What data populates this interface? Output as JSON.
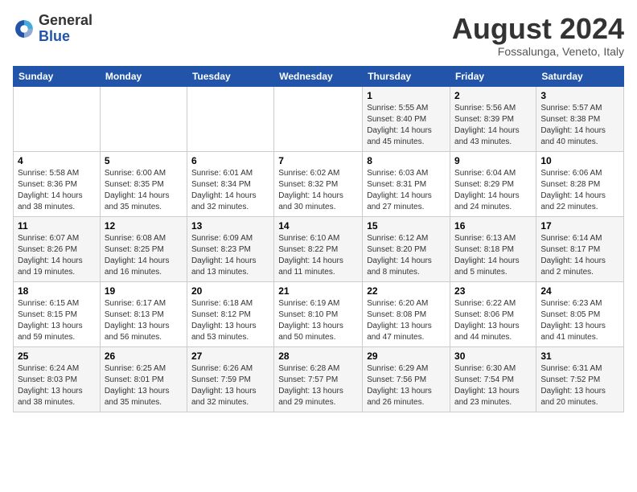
{
  "header": {
    "logo_line1": "General",
    "logo_line2": "Blue",
    "month": "August 2024",
    "location": "Fossalunga, Veneto, Italy"
  },
  "weekdays": [
    "Sunday",
    "Monday",
    "Tuesday",
    "Wednesday",
    "Thursday",
    "Friday",
    "Saturday"
  ],
  "weeks": [
    [
      {
        "day": "",
        "detail": ""
      },
      {
        "day": "",
        "detail": ""
      },
      {
        "day": "",
        "detail": ""
      },
      {
        "day": "",
        "detail": ""
      },
      {
        "day": "1",
        "detail": "Sunrise: 5:55 AM\nSunset: 8:40 PM\nDaylight: 14 hours\nand 45 minutes."
      },
      {
        "day": "2",
        "detail": "Sunrise: 5:56 AM\nSunset: 8:39 PM\nDaylight: 14 hours\nand 43 minutes."
      },
      {
        "day": "3",
        "detail": "Sunrise: 5:57 AM\nSunset: 8:38 PM\nDaylight: 14 hours\nand 40 minutes."
      }
    ],
    [
      {
        "day": "4",
        "detail": "Sunrise: 5:58 AM\nSunset: 8:36 PM\nDaylight: 14 hours\nand 38 minutes."
      },
      {
        "day": "5",
        "detail": "Sunrise: 6:00 AM\nSunset: 8:35 PM\nDaylight: 14 hours\nand 35 minutes."
      },
      {
        "day": "6",
        "detail": "Sunrise: 6:01 AM\nSunset: 8:34 PM\nDaylight: 14 hours\nand 32 minutes."
      },
      {
        "day": "7",
        "detail": "Sunrise: 6:02 AM\nSunset: 8:32 PM\nDaylight: 14 hours\nand 30 minutes."
      },
      {
        "day": "8",
        "detail": "Sunrise: 6:03 AM\nSunset: 8:31 PM\nDaylight: 14 hours\nand 27 minutes."
      },
      {
        "day": "9",
        "detail": "Sunrise: 6:04 AM\nSunset: 8:29 PM\nDaylight: 14 hours\nand 24 minutes."
      },
      {
        "day": "10",
        "detail": "Sunrise: 6:06 AM\nSunset: 8:28 PM\nDaylight: 14 hours\nand 22 minutes."
      }
    ],
    [
      {
        "day": "11",
        "detail": "Sunrise: 6:07 AM\nSunset: 8:26 PM\nDaylight: 14 hours\nand 19 minutes."
      },
      {
        "day": "12",
        "detail": "Sunrise: 6:08 AM\nSunset: 8:25 PM\nDaylight: 14 hours\nand 16 minutes."
      },
      {
        "day": "13",
        "detail": "Sunrise: 6:09 AM\nSunset: 8:23 PM\nDaylight: 14 hours\nand 13 minutes."
      },
      {
        "day": "14",
        "detail": "Sunrise: 6:10 AM\nSunset: 8:22 PM\nDaylight: 14 hours\nand 11 minutes."
      },
      {
        "day": "15",
        "detail": "Sunrise: 6:12 AM\nSunset: 8:20 PM\nDaylight: 14 hours\nand 8 minutes."
      },
      {
        "day": "16",
        "detail": "Sunrise: 6:13 AM\nSunset: 8:18 PM\nDaylight: 14 hours\nand 5 minutes."
      },
      {
        "day": "17",
        "detail": "Sunrise: 6:14 AM\nSunset: 8:17 PM\nDaylight: 14 hours\nand 2 minutes."
      }
    ],
    [
      {
        "day": "18",
        "detail": "Sunrise: 6:15 AM\nSunset: 8:15 PM\nDaylight: 13 hours\nand 59 minutes."
      },
      {
        "day": "19",
        "detail": "Sunrise: 6:17 AM\nSunset: 8:13 PM\nDaylight: 13 hours\nand 56 minutes."
      },
      {
        "day": "20",
        "detail": "Sunrise: 6:18 AM\nSunset: 8:12 PM\nDaylight: 13 hours\nand 53 minutes."
      },
      {
        "day": "21",
        "detail": "Sunrise: 6:19 AM\nSunset: 8:10 PM\nDaylight: 13 hours\nand 50 minutes."
      },
      {
        "day": "22",
        "detail": "Sunrise: 6:20 AM\nSunset: 8:08 PM\nDaylight: 13 hours\nand 47 minutes."
      },
      {
        "day": "23",
        "detail": "Sunrise: 6:22 AM\nSunset: 8:06 PM\nDaylight: 13 hours\nand 44 minutes."
      },
      {
        "day": "24",
        "detail": "Sunrise: 6:23 AM\nSunset: 8:05 PM\nDaylight: 13 hours\nand 41 minutes."
      }
    ],
    [
      {
        "day": "25",
        "detail": "Sunrise: 6:24 AM\nSunset: 8:03 PM\nDaylight: 13 hours\nand 38 minutes."
      },
      {
        "day": "26",
        "detail": "Sunrise: 6:25 AM\nSunset: 8:01 PM\nDaylight: 13 hours\nand 35 minutes."
      },
      {
        "day": "27",
        "detail": "Sunrise: 6:26 AM\nSunset: 7:59 PM\nDaylight: 13 hours\nand 32 minutes."
      },
      {
        "day": "28",
        "detail": "Sunrise: 6:28 AM\nSunset: 7:57 PM\nDaylight: 13 hours\nand 29 minutes."
      },
      {
        "day": "29",
        "detail": "Sunrise: 6:29 AM\nSunset: 7:56 PM\nDaylight: 13 hours\nand 26 minutes."
      },
      {
        "day": "30",
        "detail": "Sunrise: 6:30 AM\nSunset: 7:54 PM\nDaylight: 13 hours\nand 23 minutes."
      },
      {
        "day": "31",
        "detail": "Sunrise: 6:31 AM\nSunset: 7:52 PM\nDaylight: 13 hours\nand 20 minutes."
      }
    ]
  ]
}
